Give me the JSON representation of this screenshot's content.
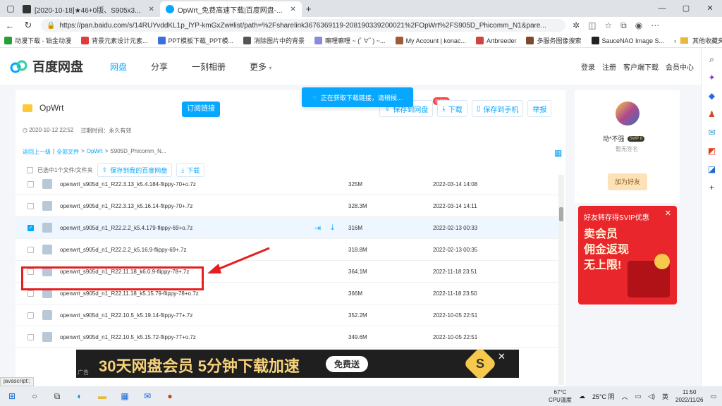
{
  "browser": {
    "tabs": [
      {
        "title": "[2020-10-18]★46+0版、S905x3...",
        "active": false
      },
      {
        "title": "OpWrt_免费高速下载|百度网盘-...",
        "active": true
      }
    ],
    "new_tab": "+",
    "url": "https://pan.baidu.com/s/14RUYvddKL1p_lYP-kmGxZw#list/path=%2Fsharelink3676369119-208190339200021%2FOpWrt%2FS905D_Phicomm_N1&pare...",
    "bookmarks": [
      "动漫下载 - 铂金动漫",
      "背景元素设计元素...",
      "PPT模板下载_PPT模...",
      "消除图片中的背景",
      "嘛哩嘛哩 ~ (ﾟ∀ﾟ) ~...",
      "My Account | konac...",
      "Artbreeder",
      "多服务图像搜索",
      "SauceNAO Image S..."
    ],
    "bookmarks_other": "其他收藏夹"
  },
  "header": {
    "logo": "百度网盘",
    "nav": [
      "网盘",
      "分享",
      "一刻相册",
      "更多"
    ],
    "right": [
      "登录",
      "注册",
      "客户端下载",
      "会员中心"
    ]
  },
  "toast": "正在获取下载链接，请稍候...",
  "share": {
    "folder": "OpWrt",
    "subscribe": "订阅链接",
    "actions": [
      "保存到网盘",
      "下载",
      "保存到手机",
      "举报"
    ],
    "badge": "领红包",
    "created": "2020-10-12 22:52",
    "expire_label": "过期时间：永久有效",
    "breadcrumb": [
      "返回上一级",
      "|",
      "全部文件",
      ">",
      "OpWrt",
      ">",
      "S905D_Phicomm_N..."
    ],
    "selected_text": "已选中1个文件/文件夹",
    "save_btn": "保存到我的百度网盘",
    "download_btn": "下载"
  },
  "files": [
    {
      "name": "openwrt_s905d_n1_R22.3.13_k5.4.184-flippy-70+o.7z",
      "size": "325M",
      "date": "2022-03-14 14:08",
      "checked": false
    },
    {
      "name": "openwrt_s905d_n1_R22.3.13_k5.16.14-flippy-70+.7z",
      "size": "328.3M",
      "date": "2022-03-14 14:11",
      "checked": false
    },
    {
      "name": "openwrt_s905d_n1_R22.2.2_k5.4.179-flippy-69+o.7z",
      "size": "316M",
      "date": "2022-02-13 00:33",
      "checked": true
    },
    {
      "name": "openwrt_s905d_n1_R22.2.2_k5.16.9-flippy-69+.7z",
      "size": "318.8M",
      "date": "2022-02-13 00:35",
      "checked": false
    },
    {
      "name": "openwrt_s905d_n1_R22.11.18_k6.0.9-flippy-78+.7z",
      "size": "364.1M",
      "date": "2022-11-18 23:51",
      "checked": false
    },
    {
      "name": "openwrt_s905d_n1_R22.11.18_k5.15.79-flippy-78+o.7z",
      "size": "366M",
      "date": "2022-11-18 23:50",
      "checked": false
    },
    {
      "name": "openwrt_s905d_n1_R22.10.5_k5.19.14-flippy-77+.7z",
      "size": "352.2M",
      "date": "2022-10-05 22:51",
      "checked": false
    },
    {
      "name": "openwrt_s905d_n1_R22.10.5_k5.15.72-flippy-77+o.7z",
      "size": "349.6M",
      "date": "2022-10-05 22:51",
      "checked": false
    }
  ],
  "profile": {
    "name": "动*不强",
    "level": "SWP 8",
    "sign": "暂无签名",
    "add_friend": "加为好友"
  },
  "ad": {
    "line1": "好友转存得SVIP优惠",
    "line2": "卖会员",
    "line3": "佣金返现",
    "line4": "无上限!"
  },
  "banner": {
    "tag": "广告",
    "headline": "30天网盘会员 5分钟下载加速",
    "cta": "免费送",
    "s": "S"
  },
  "statusbar": "javascript:;",
  "taskbar": {
    "weather1": "67°C",
    "weather1b": "CPU温度",
    "weather2": "25°C 阴",
    "ime": "英",
    "time": "11:50",
    "date": "2022/11/26"
  },
  "colors": {
    "accent": "#06a7ff",
    "highlight": "#e61e1e"
  }
}
